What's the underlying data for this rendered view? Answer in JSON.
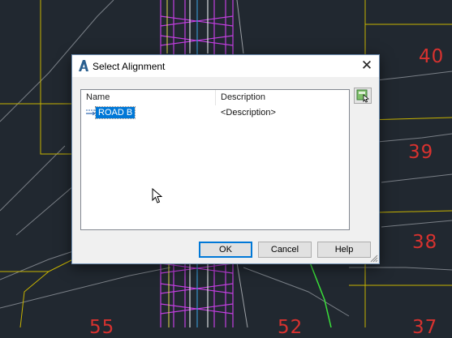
{
  "dialog": {
    "title": "Select Alignment",
    "columns": [
      "Name",
      "Description"
    ],
    "rows": [
      {
        "name": "ROAD B",
        "description": "<Description>",
        "selected": true
      }
    ],
    "buttons": {
      "ok": "OK",
      "cancel": "Cancel",
      "help": "Help"
    }
  },
  "background": {
    "lot_numbers": [
      "40",
      "39",
      "38",
      "55",
      "52",
      "37"
    ]
  },
  "icons": {
    "app": "autocad-civil-a-icon",
    "close": "close-icon",
    "row": "alignment-icon",
    "pick": "pick-from-drawing-icon"
  },
  "colors": {
    "selection": "#0078d7",
    "cad_background": "#212830",
    "lot_text": "#d8322f",
    "lot_lines": "#c8b400",
    "contour_lines": "#8a8f96",
    "road": "#c23fe0"
  }
}
